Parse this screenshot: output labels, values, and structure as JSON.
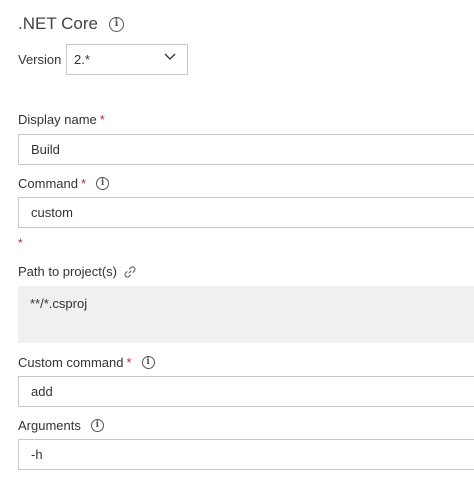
{
  "task": {
    "title": ".NET Core",
    "info_icon": "info-icon"
  },
  "version": {
    "label": "Version",
    "selected": "2.*",
    "chevron_icon": "chevron-down-icon"
  },
  "fields": {
    "display_name": {
      "label": "Display name",
      "required_mark": "*",
      "value": "Build"
    },
    "command": {
      "label": "Command",
      "required_mark": "*",
      "info_icon": "info-icon",
      "value": "custom",
      "error_mark": "*"
    },
    "path_to_projects": {
      "label": "Path to project(s)",
      "link_icon": "link-icon",
      "value": "**/*.csproj"
    },
    "custom_command": {
      "label": "Custom command",
      "required_mark": "*",
      "info_icon": "info-icon",
      "value": "add"
    },
    "arguments": {
      "label": "Arguments",
      "info_icon": "info-icon",
      "value": "-h"
    }
  },
  "colors": {
    "required": "#c4262e",
    "border": "#c8c8c8",
    "textarea_bg": "#f0f0f0",
    "text": "#333333"
  }
}
